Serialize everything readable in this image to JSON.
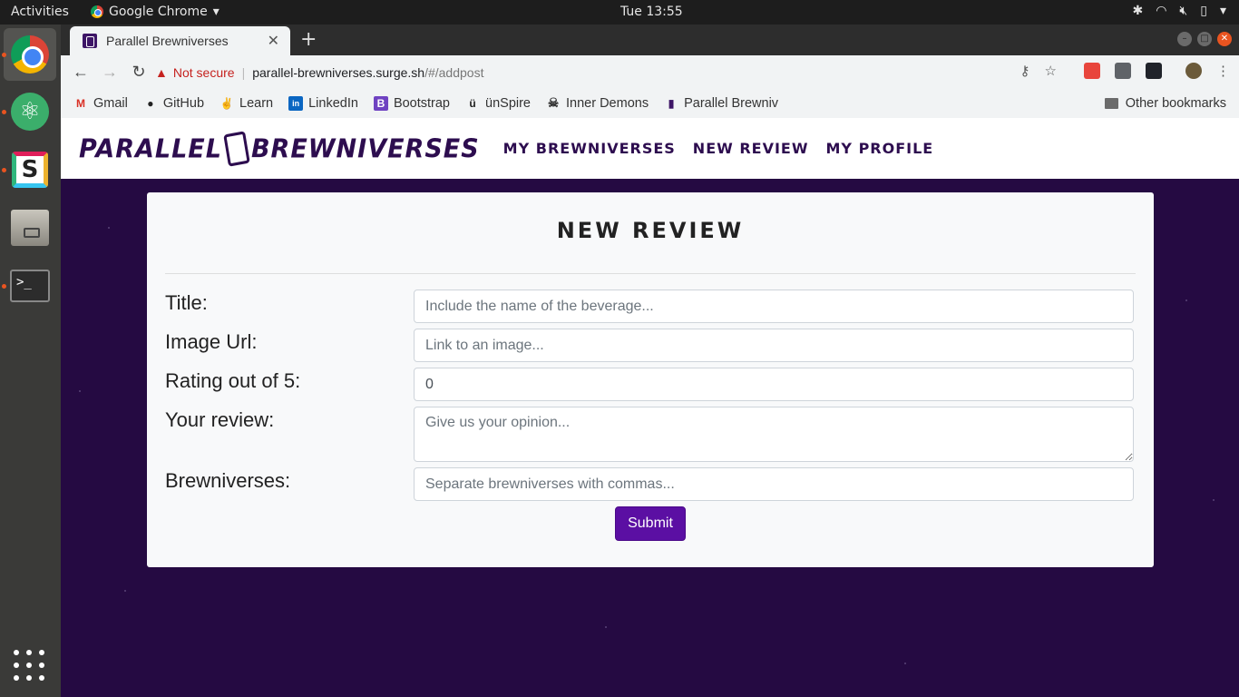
{
  "topbar": {
    "activities": "Activities",
    "app_menu": "Google Chrome",
    "clock": "Tue 13:55"
  },
  "dock": {
    "apps": [
      "chrome-icon",
      "atom-icon",
      "slack-icon",
      "files-icon",
      "terminal-icon",
      "show-apps-icon"
    ],
    "terminal_glyph": ">_"
  },
  "browser": {
    "tab_title": "Parallel Brewniverses",
    "security_label": "Not secure",
    "url_host": "parallel-brewniverses.surge.sh",
    "url_path": "/#/addpost",
    "bookmarks": [
      {
        "label": "Gmail",
        "icon": "M",
        "color": "#d93025"
      },
      {
        "label": "GitHub",
        "icon": "●",
        "color": "#222222"
      },
      {
        "label": "Learn",
        "icon": "✌",
        "color": "#e8a13a"
      },
      {
        "label": "LinkedIn",
        "icon": "in",
        "color": "#0a66c2"
      },
      {
        "label": "Bootstrap",
        "icon": "B",
        "color": "#6f42c1"
      },
      {
        "label": "ünSpire",
        "icon": "ü",
        "color": "#222222"
      },
      {
        "label": "Inner Demons",
        "icon": "☠",
        "color": "#333333"
      },
      {
        "label": "Parallel Brewniv",
        "icon": "▮",
        "color": "#3d1566"
      }
    ],
    "other_bookmarks": "Other bookmarks"
  },
  "site": {
    "logo_left": "PARALLEL",
    "logo_right": "BREWNIVERSES",
    "nav": [
      "MY BREWNIVERSES",
      "NEW REVIEW",
      "MY PROFILE"
    ]
  },
  "form": {
    "heading": "NEW REVIEW",
    "fields": {
      "title": {
        "label": "Title:",
        "placeholder": "Include the name of the beverage..."
      },
      "image": {
        "label": "Image Url:",
        "placeholder": "Link to an image..."
      },
      "rating": {
        "label": "Rating out of 5:",
        "value": "0"
      },
      "review": {
        "label": "Your review:",
        "placeholder": "Give us your opinion..."
      },
      "brewniverses": {
        "label": "Brewniverses:",
        "placeholder": "Separate brewniverses with commas..."
      }
    },
    "submit_label": "Submit"
  },
  "colors": {
    "page_background": "#250a42",
    "brand": "#2d0d4f",
    "submit": "#5b0fa3"
  }
}
